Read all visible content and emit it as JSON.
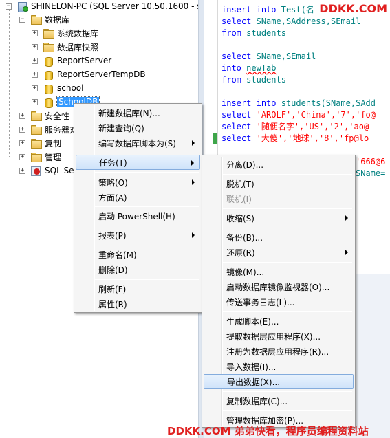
{
  "tree": {
    "server": "SHINELON-PC (SQL Server 10.50.1600 - s",
    "databases_folder": "数据库",
    "items": [
      {
        "label": "系统数据库",
        "icon": "folder-icon"
      },
      {
        "label": "数据库快照",
        "icon": "folder-icon"
      },
      {
        "label": "ReportServer",
        "icon": "database-icon"
      },
      {
        "label": "ReportServerTempDB",
        "icon": "database-icon"
      },
      {
        "label": "school",
        "icon": "database-icon"
      },
      {
        "label": "SchoolDB",
        "icon": "database-icon"
      }
    ],
    "top_folders": [
      {
        "label": "安全性"
      },
      {
        "label": "服务器对"
      },
      {
        "label": "复制"
      },
      {
        "label": "管理"
      }
    ],
    "sql_agent": "SQL Ser"
  },
  "editor": {
    "lines": [
      [
        {
          "t": "insert",
          "c": "kw"
        },
        {
          "t": " "
        },
        {
          "t": "into",
          "c": "kw"
        },
        {
          "t": " "
        },
        {
          "t": "Test",
          "c": "id"
        },
        {
          "t": "(名",
          "c": "id"
        }
      ],
      [
        {
          "t": "select",
          "c": "kw"
        },
        {
          "t": " "
        },
        {
          "t": "SName,SAddress,SEmail",
          "c": "id"
        }
      ],
      [
        {
          "t": "from",
          "c": "kw"
        },
        {
          "t": " "
        },
        {
          "t": "students",
          "c": "id"
        }
      ],
      [],
      [
        {
          "t": "select",
          "c": "kw"
        },
        {
          "t": " "
        },
        {
          "t": "SName,SEmail",
          "c": "id"
        }
      ],
      [
        {
          "t": "into",
          "c": "kw"
        },
        {
          "t": " "
        },
        {
          "t": "newTab",
          "c": "id sq"
        }
      ],
      [
        {
          "t": "from",
          "c": "kw"
        },
        {
          "t": " "
        },
        {
          "t": "students",
          "c": "id"
        }
      ],
      [],
      [
        {
          "t": "insert",
          "c": "kw"
        },
        {
          "t": " "
        },
        {
          "t": "into",
          "c": "kw"
        },
        {
          "t": " "
        },
        {
          "t": "students(SName,SAdd",
          "c": "id"
        }
      ],
      [
        {
          "t": "select",
          "c": "kw"
        },
        {
          "t": " "
        },
        {
          "t": "'AROLF','China','7','fo@",
          "c": "str"
        }
      ],
      [
        {
          "t": "select",
          "c": "kw"
        },
        {
          "t": " "
        },
        {
          "t": "'随便名字','US','2','ao@",
          "c": "str"
        }
      ],
      [
        {
          "t": "select",
          "c": "kw"
        },
        {
          "t": " "
        },
        {
          "t": "'大傻','地球','8','fp@lo",
          "c": "str"
        }
      ]
    ],
    "fragment1": "'666@6",
    "fragment2": "SName="
  },
  "context_menu": {
    "items": [
      {
        "label": "新建数据库(N)..."
      },
      {
        "label": "新建查询(Q)"
      },
      {
        "label": "编写数据库脚本为(S)",
        "submenu": true
      },
      {
        "label": "任务(T)",
        "submenu": true,
        "highlighted": true
      },
      {
        "label": "策略(O)",
        "submenu": true
      },
      {
        "label": "方面(A)"
      },
      {
        "label": "启动 PowerShell(H)"
      },
      {
        "label": "报表(P)",
        "submenu": true
      },
      {
        "label": "重命名(M)"
      },
      {
        "label": "删除(D)"
      },
      {
        "label": "刷新(F)"
      },
      {
        "label": "属性(R)"
      }
    ]
  },
  "tasks_menu": {
    "items": [
      {
        "label": "分离(D)..."
      },
      {
        "label": "脱机(T)"
      },
      {
        "label": "联机(I)",
        "disabled": true
      },
      {
        "label": "收缩(S)",
        "submenu": true
      },
      {
        "label": "备份(B)..."
      },
      {
        "label": "还原(R)",
        "submenu": true
      },
      {
        "label": "镜像(M)..."
      },
      {
        "label": "启动数据库镜像监视器(O)..."
      },
      {
        "label": "传送事务日志(L)..."
      },
      {
        "label": "生成脚本(E)..."
      },
      {
        "label": "提取数据层应用程序(X)..."
      },
      {
        "label": "注册为数据层应用程序(R)..."
      },
      {
        "label": "导入数据(I)..."
      },
      {
        "label": "导出数据(X)...",
        "highlighted": true
      },
      {
        "label": "复制数据库(C)..."
      },
      {
        "label": "管理数据库加密(P)..."
      }
    ]
  },
  "watermarks": {
    "top": "DDKK.COM",
    "bottom": "DDKK.COM 弟弟快看，程序员编程资料站"
  }
}
